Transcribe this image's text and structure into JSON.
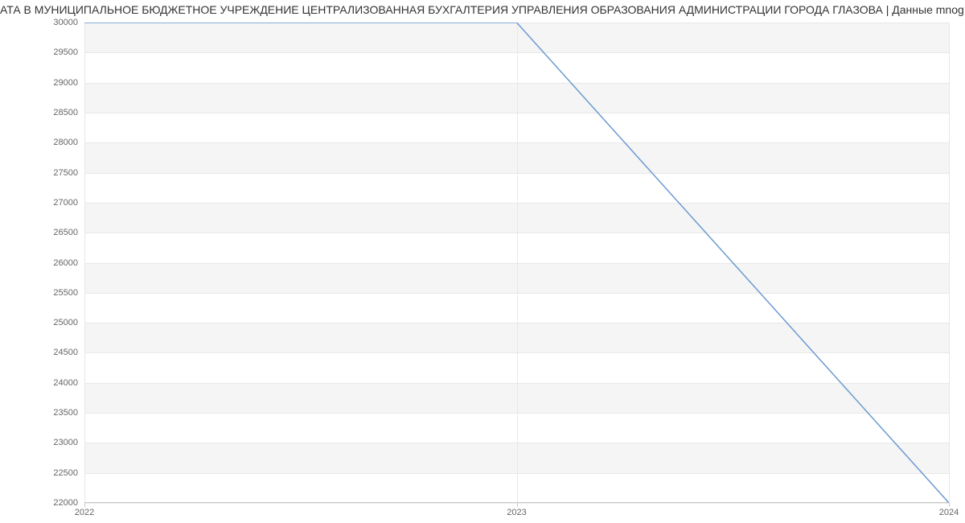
{
  "chart_data": {
    "type": "line",
    "title": "АТА В МУНИЦИПАЛЬНОЕ БЮДЖЕТНОЕ УЧРЕЖДЕНИЕ ЦЕНТРАЛИЗОВАННАЯ БУХГАЛТЕРИЯ УПРАВЛЕНИЯ ОБРАЗОВАНИЯ АДМИНИСТРАЦИИ ГОРОДА ГЛАЗОВА | Данные mnog",
    "x": [
      2022,
      2023,
      2024
    ],
    "values": [
      30000,
      30000,
      22000
    ],
    "xlabel": "",
    "ylabel": "",
    "xlim": [
      2022,
      2024
    ],
    "ylim": [
      22000,
      30000
    ],
    "y_ticks": [
      22000,
      22500,
      23000,
      23500,
      24000,
      24500,
      25000,
      25500,
      26000,
      26500,
      27000,
      27500,
      28000,
      28500,
      29000,
      29500,
      30000
    ],
    "x_ticks": [
      2022,
      2023,
      2024
    ]
  }
}
